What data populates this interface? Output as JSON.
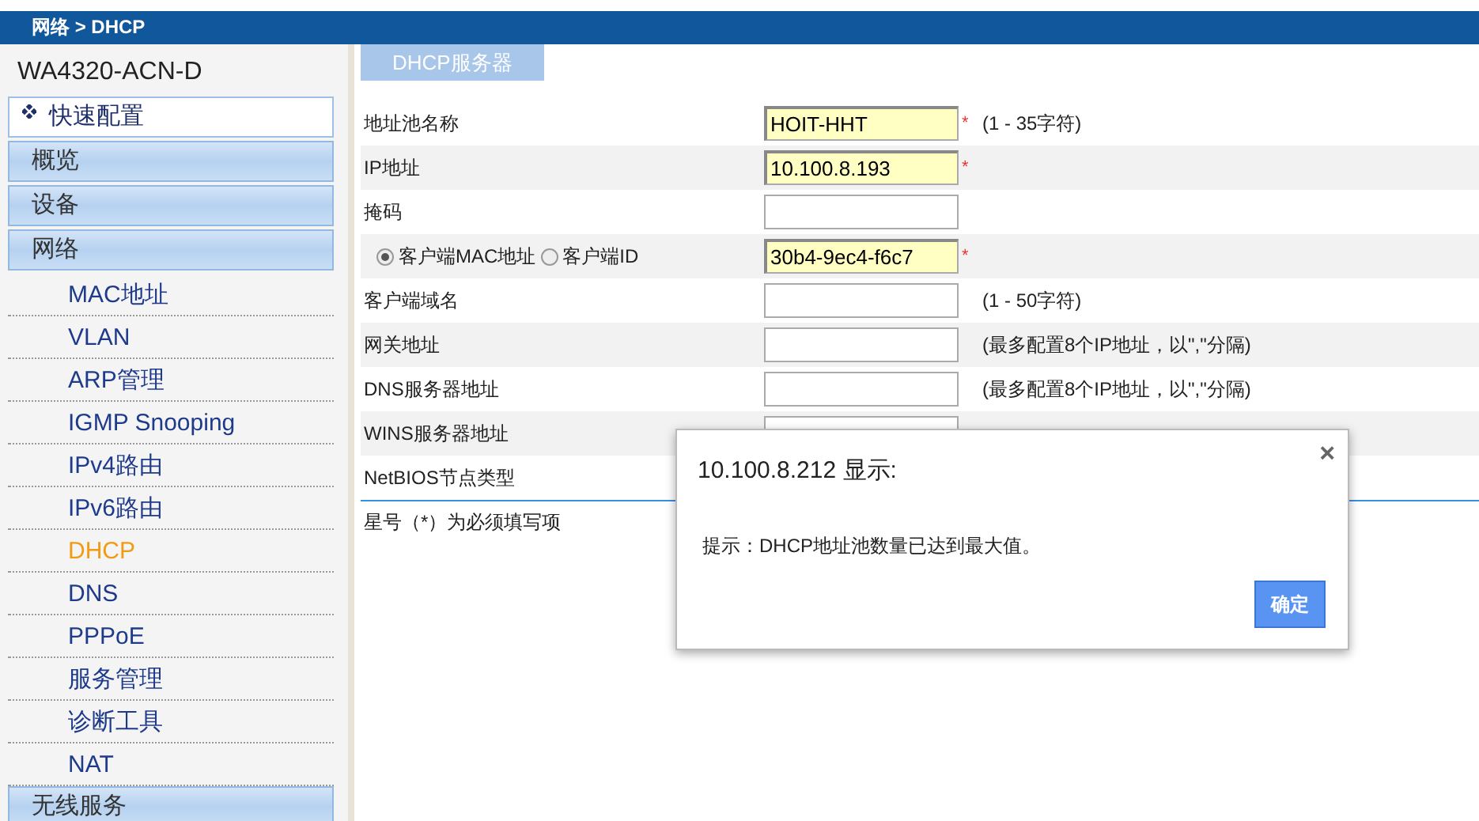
{
  "breadcrumb": "网络 > DHCP",
  "sidebar": {
    "device_name": "WA4320-ACN-D",
    "items": [
      {
        "kind": "quick",
        "label": "快速配置"
      },
      {
        "kind": "group",
        "label": "概览"
      },
      {
        "kind": "group",
        "label": "设备"
      },
      {
        "kind": "group",
        "label": "网络",
        "children": [
          {
            "label": "MAC地址",
            "selected": false
          },
          {
            "label": "VLAN",
            "selected": false
          },
          {
            "label": "ARP管理",
            "selected": false
          },
          {
            "label": "IGMP Snooping",
            "selected": false
          },
          {
            "label": "IPv4路由",
            "selected": false
          },
          {
            "label": "IPv6路由",
            "selected": false
          },
          {
            "label": "DHCP",
            "selected": true
          },
          {
            "label": "DNS",
            "selected": false
          },
          {
            "label": "PPPoE",
            "selected": false
          },
          {
            "label": "服务管理",
            "selected": false
          },
          {
            "label": "诊断工具",
            "selected": false
          },
          {
            "label": "NAT",
            "selected": false
          }
        ]
      },
      {
        "kind": "group",
        "label": "无线服务"
      }
    ]
  },
  "tabs": [
    {
      "label": "DHCP服务器",
      "selected": true
    }
  ],
  "form": {
    "rows": [
      {
        "kind": "text",
        "label": "地址池名称",
        "value": "HOIT-HHT",
        "mark": "*",
        "hint": "(1 - 35字符)"
      },
      {
        "kind": "text",
        "label": "IP地址",
        "value": "10.100.8.193",
        "mark": "*"
      },
      {
        "kind": "text",
        "label": "掩码"
      },
      {
        "kind": "radio",
        "options": [
          {
            "label": "客户端MAC地址",
            "selected": true
          },
          {
            "label": "客户端ID",
            "selected": false
          }
        ],
        "value": "30b4-9ec4-f6c7",
        "mark": "*"
      },
      {
        "kind": "text",
        "label": "客户端域名",
        "hint": "(1 - 50字符)"
      },
      {
        "kind": "text",
        "label": "网关地址",
        "hint": "(最多配置8个IP地址，以\",\"分隔)"
      },
      {
        "kind": "text",
        "label": "DNS服务器地址",
        "hint": "(最多配置8个IP地址，以\",\"分隔)"
      },
      {
        "kind": "text",
        "label": "WINS服务器地址"
      },
      {
        "kind": "label",
        "label": "NetBIOS节点类型"
      }
    ],
    "note": "星号（*）为必须填写项"
  },
  "dialog": {
    "title": "10.100.8.212 显示:",
    "close": "×",
    "message": "提示：DHCP地址池数量已达到最大值。",
    "button": "确定"
  }
}
